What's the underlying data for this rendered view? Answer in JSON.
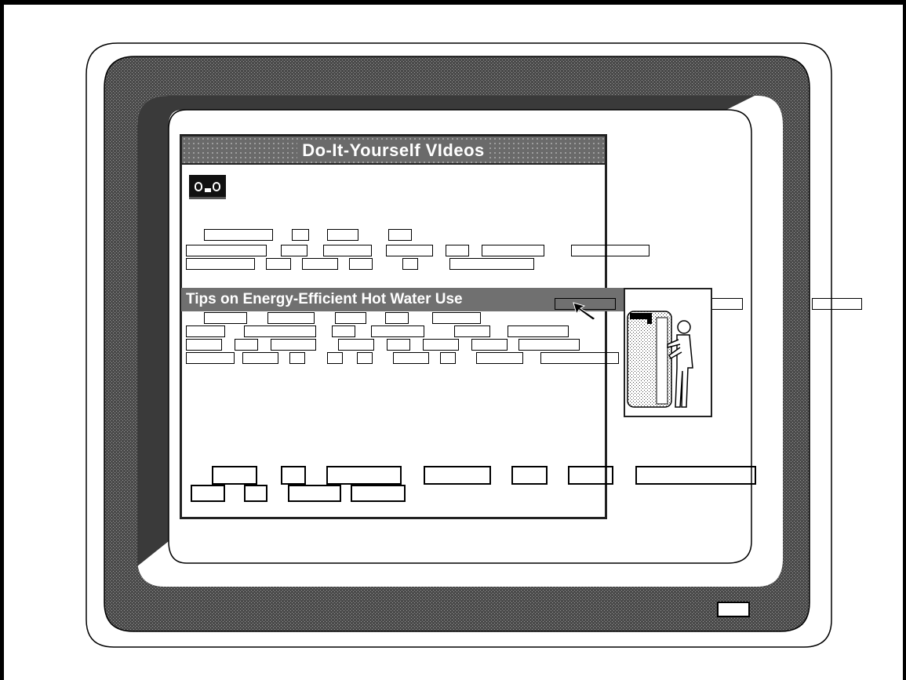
{
  "window": {
    "title": "Do-It-Yourself VIdeos"
  },
  "content": {
    "video_link": "Tips on Energy-Efficient Hot Water Use",
    "icons": {
      "tape": "videotape-icon",
      "cursor": "arrow-cursor-icon",
      "illustration": "water-heater-illustration-icon",
      "power": "power-button-icon"
    }
  },
  "colors": {
    "bezel_dark": "#555555",
    "bezel_shadow": "#3a3a3a",
    "titlebar": "#6a6a6a",
    "highlight": "#707070"
  }
}
